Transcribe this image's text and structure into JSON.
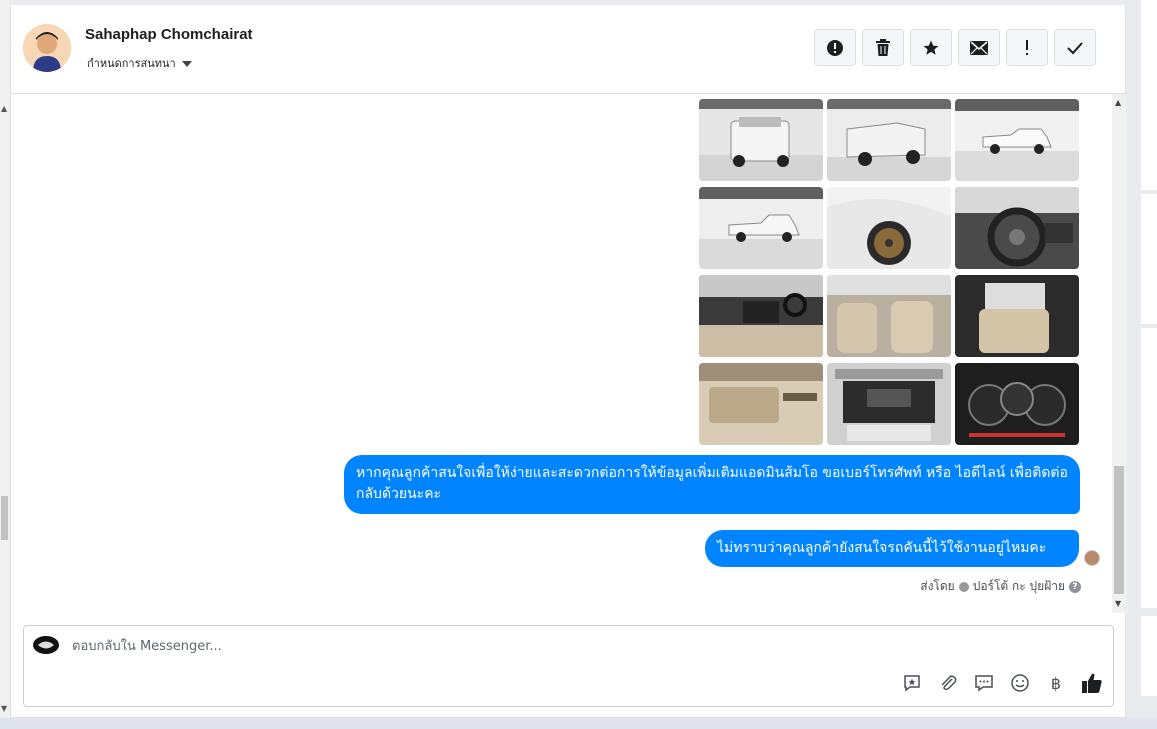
{
  "contact": {
    "name": "Sahaphap Chomchairat",
    "conversation_menu_label": "กำหนดการสนทนา"
  },
  "toolbar": {
    "buttons": [
      {
        "name": "spam",
        "icon": "alert-circle-icon"
      },
      {
        "name": "delete",
        "icon": "trash-icon"
      },
      {
        "name": "star",
        "icon": "star-icon"
      },
      {
        "name": "mark-unread",
        "icon": "envelope-icon"
      },
      {
        "name": "follow-up",
        "icon": "exclamation-icon"
      },
      {
        "name": "mark-done",
        "icon": "checkmark-icon"
      }
    ]
  },
  "photos": [
    {
      "subject": "truck-rear-view"
    },
    {
      "subject": "truck-rear-angle"
    },
    {
      "subject": "truck-side-far"
    },
    {
      "subject": "truck-side"
    },
    {
      "subject": "wheel-closeup"
    },
    {
      "subject": "steering-wheel"
    },
    {
      "subject": "dashboard-interior"
    },
    {
      "subject": "front-seats"
    },
    {
      "subject": "rear-seat"
    },
    {
      "subject": "door-panel"
    },
    {
      "subject": "engine-bay"
    },
    {
      "subject": "gauge-cluster"
    }
  ],
  "messages": {
    "message1": "หากคุณลูกค้าสนใจเพื่อให้ง่ายและสะดวกต่อการให้ข้อมูลเพิ่มเติมแอดมินส้มโอ ขอเบอร์โทรศัพท์ หรือ ไอดีไลน์ เพื่อติดต่อกลับด้วยนะคะ",
    "message2": "ไม่ทราบว่าคุณลูกค้ายังสนใจรถคันนี้ไว้ใช้งานอยู่ไหมคะ",
    "sent_by_label": "ส่งโดย",
    "sent_by_name": "ปอร์โต้ กะ ปุยฝ้าย"
  },
  "composer": {
    "placeholder": "ตอบกลับใน Messenger...",
    "tools": [
      "saved-reply-icon",
      "attachment-icon",
      "chat-bubble-icon",
      "emoji-icon",
      "baht-icon",
      "thumbs-up-icon"
    ],
    "baht_symbol": "฿"
  },
  "colors": {
    "bubble": "#0084ff",
    "panel_bg": "#ffffff",
    "page_bg": "#e9ebee"
  }
}
